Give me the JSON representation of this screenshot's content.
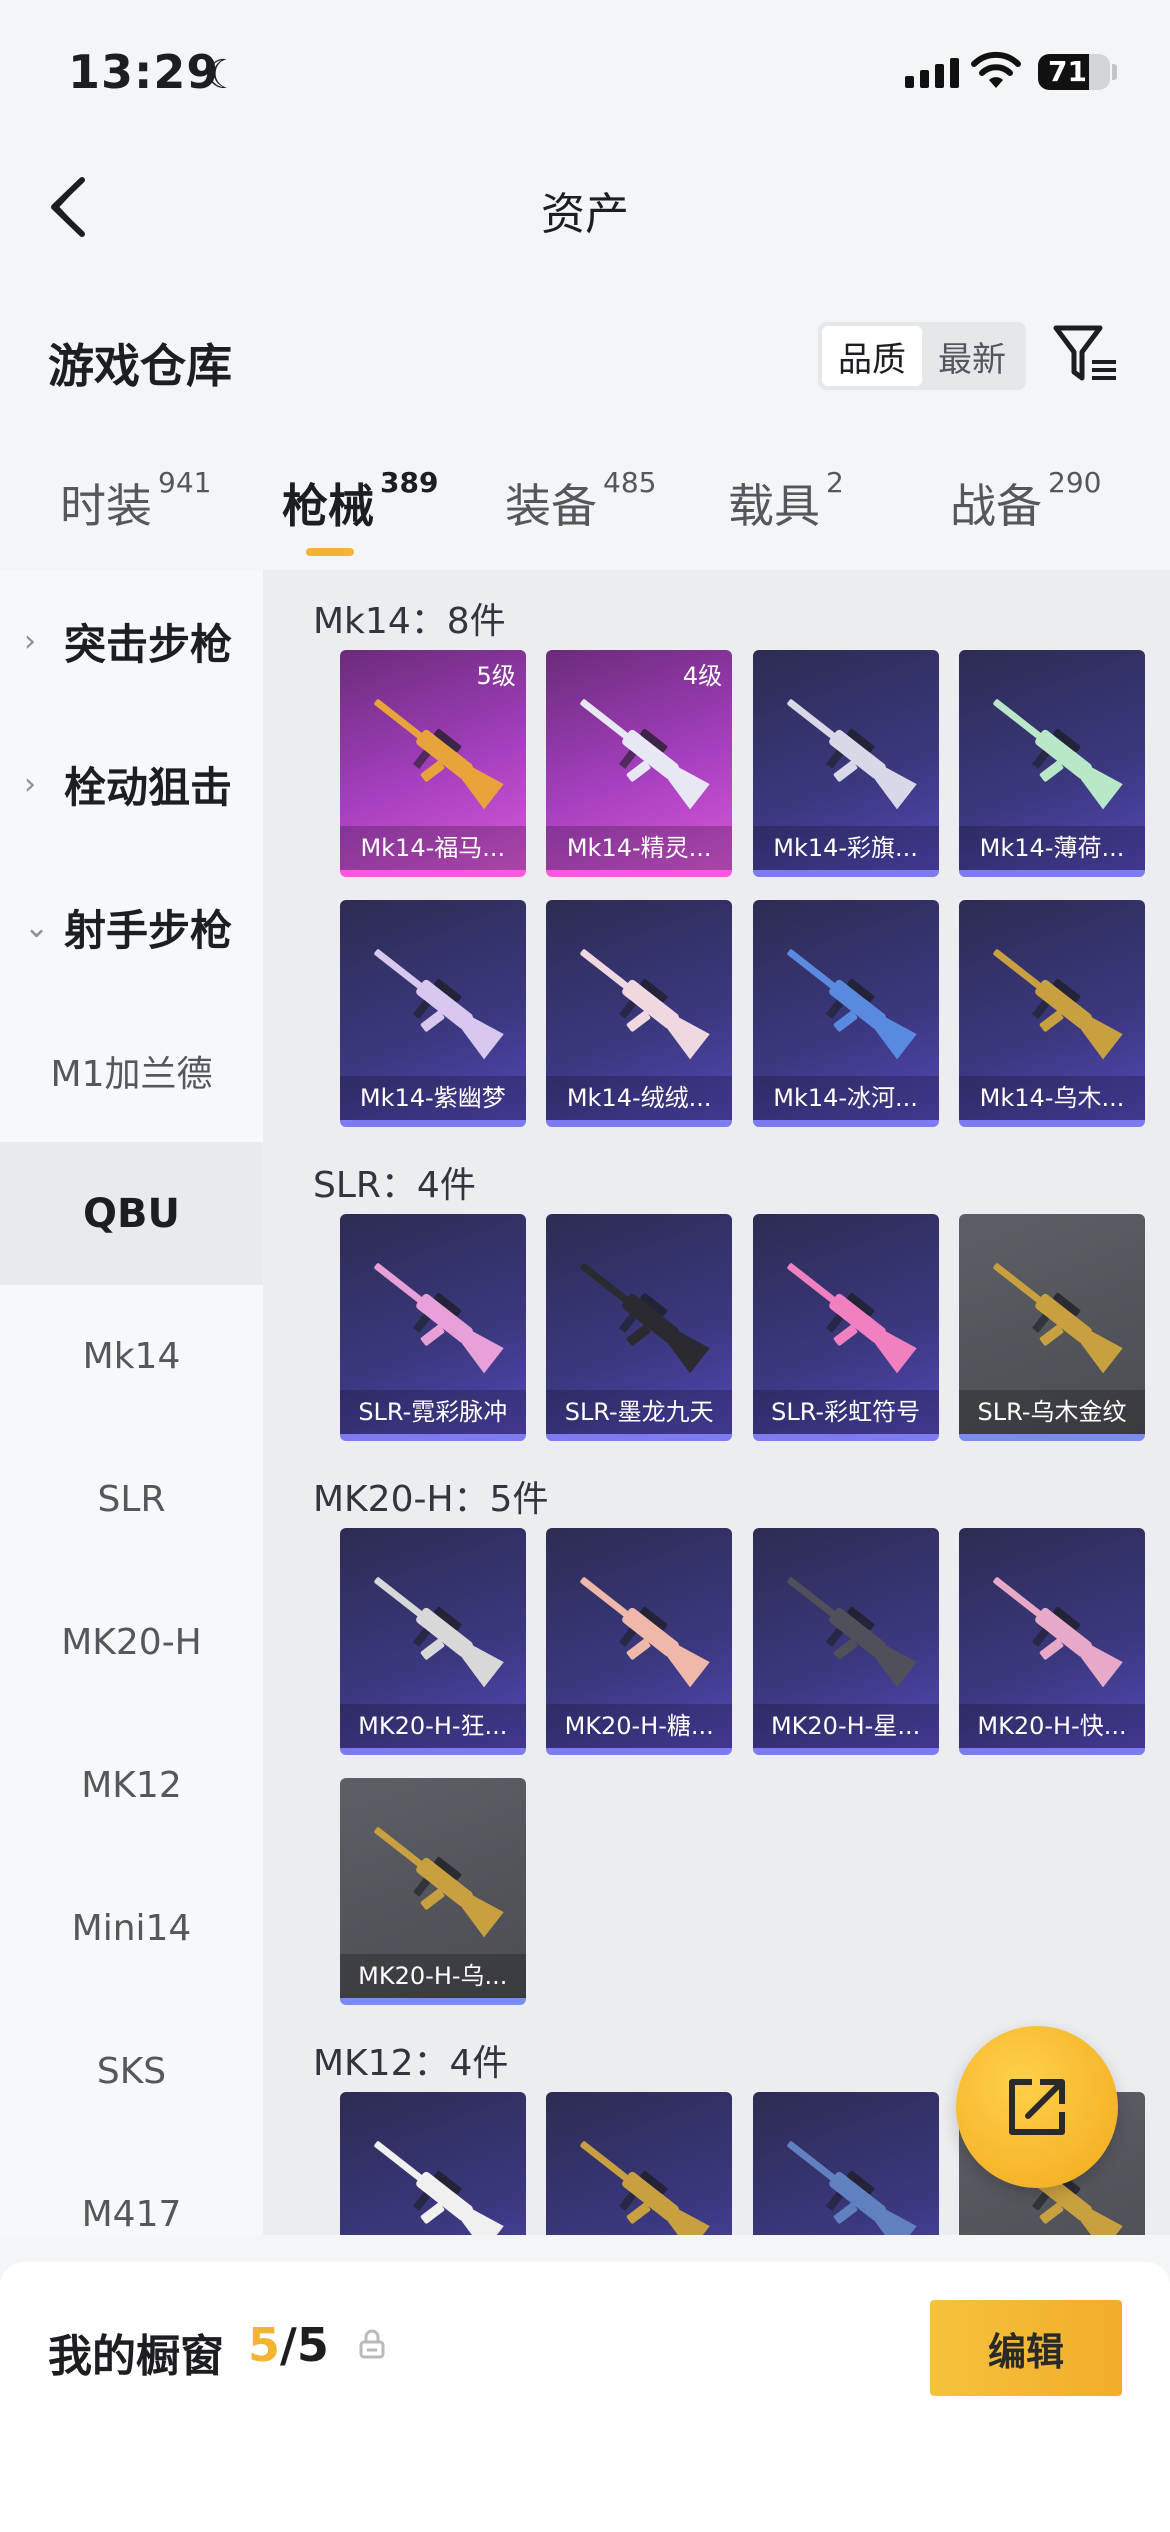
{
  "status_bar": {
    "time": "13:29",
    "battery": "71",
    "battery_level": 0.71
  },
  "header": {
    "title": "资产"
  },
  "section": {
    "title": "游戏仓库"
  },
  "sort": {
    "options": [
      "品质",
      "最新"
    ],
    "active": "品质"
  },
  "tabs": [
    {
      "label": "时装",
      "count": "941"
    },
    {
      "label": "枪械",
      "count": "389",
      "active": true
    },
    {
      "label": "装备",
      "count": "485"
    },
    {
      "label": "载具",
      "count": "2"
    },
    {
      "label": "战备",
      "count": "290"
    }
  ],
  "side_menu": {
    "groups": [
      {
        "label": "突击步枪",
        "chevron": "›"
      },
      {
        "label": "栓动狙击",
        "chevron": "›"
      },
      {
        "label": "射手步枪",
        "chevron": "⌄"
      }
    ],
    "items": [
      "M1加兰德",
      "QBU",
      "Mk14",
      "SLR",
      "MK20-H",
      "MK12",
      "Mini14",
      "SKS",
      "M417"
    ],
    "active_item": "QBU"
  },
  "weapon_groups": [
    {
      "title": "Mk14：8件",
      "items": [
        {
          "name": "Mk14-福马...",
          "level": "5级",
          "tier": "pink",
          "accent": "#e8a33a"
        },
        {
          "name": "Mk14-精灵...",
          "level": "4级",
          "tier": "pink",
          "accent": "#e8e8f4"
        },
        {
          "name": "Mk14-彩旗...",
          "tier": "blue",
          "accent": "#d8d8e8"
        },
        {
          "name": "Mk14-薄荷...",
          "tier": "blue",
          "accent": "#b8e8c8"
        },
        {
          "name": "Mk14-紫幽梦",
          "tier": "blue",
          "accent": "#d8c8f0"
        },
        {
          "name": "Mk14-绒绒...",
          "tier": "blue",
          "accent": "#f0d8e0"
        },
        {
          "name": "Mk14-冰河...",
          "tier": "blue",
          "accent": "#5a8ae0"
        },
        {
          "name": "Mk14-乌木...",
          "tier": "blue",
          "accent": "#c8a040"
        }
      ]
    },
    {
      "title": "SLR：4件",
      "items": [
        {
          "name": "SLR-霓彩脉冲",
          "tier": "blue",
          "accent": "#e8a0d8"
        },
        {
          "name": "SLR-墨龙九天",
          "tier": "blue",
          "accent": "#2a2a30"
        },
        {
          "name": "SLR-彩虹符号",
          "tier": "blue",
          "accent": "#f080c0"
        },
        {
          "name": "SLR-乌木金纹",
          "tier": "gray",
          "accent": "#c8a040"
        }
      ]
    },
    {
      "title": "MK20-H：5件",
      "items": [
        {
          "name": "MK20-H-狂...",
          "tier": "blue",
          "accent": "#d8d8d8"
        },
        {
          "name": "MK20-H-糖...",
          "tier": "blue",
          "accent": "#f0b8a8"
        },
        {
          "name": "MK20-H-星...",
          "tier": "blue",
          "accent": "#50505a"
        },
        {
          "name": "MK20-H-快...",
          "tier": "blue",
          "accent": "#e8a8c8"
        },
        {
          "name": "MK20-H-乌...",
          "tier": "gray",
          "accent": "#c8a040"
        }
      ]
    },
    {
      "title": "MK12：4件",
      "items": [
        {
          "name": "",
          "tier": "blue",
          "accent": "#f0f0f0"
        },
        {
          "name": "",
          "tier": "blue",
          "accent": "#c8a040"
        },
        {
          "name": "",
          "tier": "blue",
          "accent": "#6080c0"
        },
        {
          "name": "",
          "tier": "gray",
          "accent": "#c8a040"
        }
      ]
    }
  ],
  "showcase": {
    "title": "我的橱窗",
    "current": "5",
    "total": "/5",
    "edit_label": "编辑"
  }
}
